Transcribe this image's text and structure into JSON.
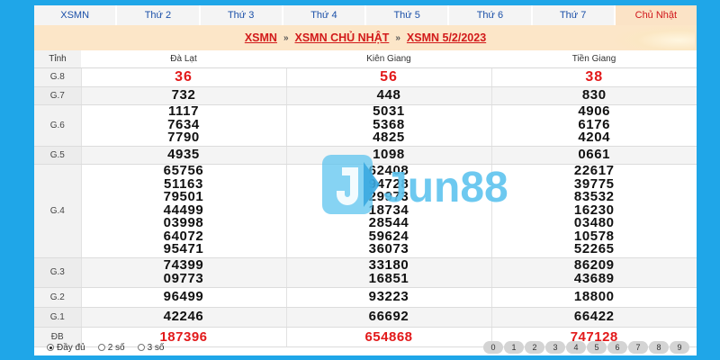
{
  "tabs": [
    {
      "label": "XSMN"
    },
    {
      "label": "Thứ 2"
    },
    {
      "label": "Thứ 3"
    },
    {
      "label": "Thứ 4"
    },
    {
      "label": "Thứ 5"
    },
    {
      "label": "Thứ 6"
    },
    {
      "label": "Thứ 7"
    },
    {
      "label": "Chủ Nhật"
    }
  ],
  "breadcrumb": {
    "items": [
      "XSMN",
      "XSMN CHỦ NHẬT",
      "XSMN 5/2/2023"
    ],
    "separator": "»"
  },
  "table": {
    "label_header": "Tỉnh",
    "provinces": [
      "Đà Lạt",
      "Kiên Giang",
      "Tiền Giang"
    ],
    "rows": [
      {
        "label": "G.8",
        "values": [
          [
            "36"
          ],
          [
            "56"
          ],
          [
            "38"
          ]
        ]
      },
      {
        "label": "G.7",
        "values": [
          [
            "732"
          ],
          [
            "448"
          ],
          [
            "830"
          ]
        ]
      },
      {
        "label": "G.6",
        "values": [
          [
            "1117",
            "7634",
            "7790"
          ],
          [
            "5031",
            "5368",
            "4825"
          ],
          [
            "4906",
            "6176",
            "4204"
          ]
        ]
      },
      {
        "label": "G.5",
        "values": [
          [
            "4935"
          ],
          [
            "1098"
          ],
          [
            "0661"
          ]
        ]
      },
      {
        "label": "G.4",
        "values": [
          [
            "65756",
            "51163",
            "79501",
            "44499",
            "03998",
            "64072",
            "95471"
          ],
          [
            "62408",
            "94728",
            "29973",
            "18734",
            "28544",
            "59624",
            "36073"
          ],
          [
            "22617",
            "39775",
            "83532",
            "16230",
            "03480",
            "10578",
            "52265"
          ]
        ]
      },
      {
        "label": "G.3",
        "values": [
          [
            "74399",
            "09773"
          ],
          [
            "33180",
            "16851"
          ],
          [
            "86209",
            "43689"
          ]
        ]
      },
      {
        "label": "G.2",
        "values": [
          [
            "96499"
          ],
          [
            "93223"
          ],
          [
            "18800"
          ]
        ]
      },
      {
        "label": "G.1",
        "values": [
          [
            "42246"
          ],
          [
            "66692"
          ],
          [
            "66422"
          ]
        ]
      },
      {
        "label": "ĐB",
        "values": [
          [
            "187396"
          ],
          [
            "654868"
          ],
          [
            "747128"
          ]
        ]
      }
    ]
  },
  "footer": {
    "options": [
      {
        "label": "Đầy đủ",
        "selected": true
      },
      {
        "label": "2 số",
        "selected": false
      },
      {
        "label": "3 số",
        "selected": false
      }
    ],
    "digits": [
      "0",
      "1",
      "2",
      "3",
      "4",
      "5",
      "6",
      "7",
      "8",
      "9"
    ]
  },
  "watermark": {
    "logo_text": "Jun88"
  },
  "colors": {
    "background": "#1fa6e8",
    "accent_red": "#d21a1a",
    "breadcrumb_bg": "#fce6c8",
    "watermark": "#5ec4ef"
  }
}
